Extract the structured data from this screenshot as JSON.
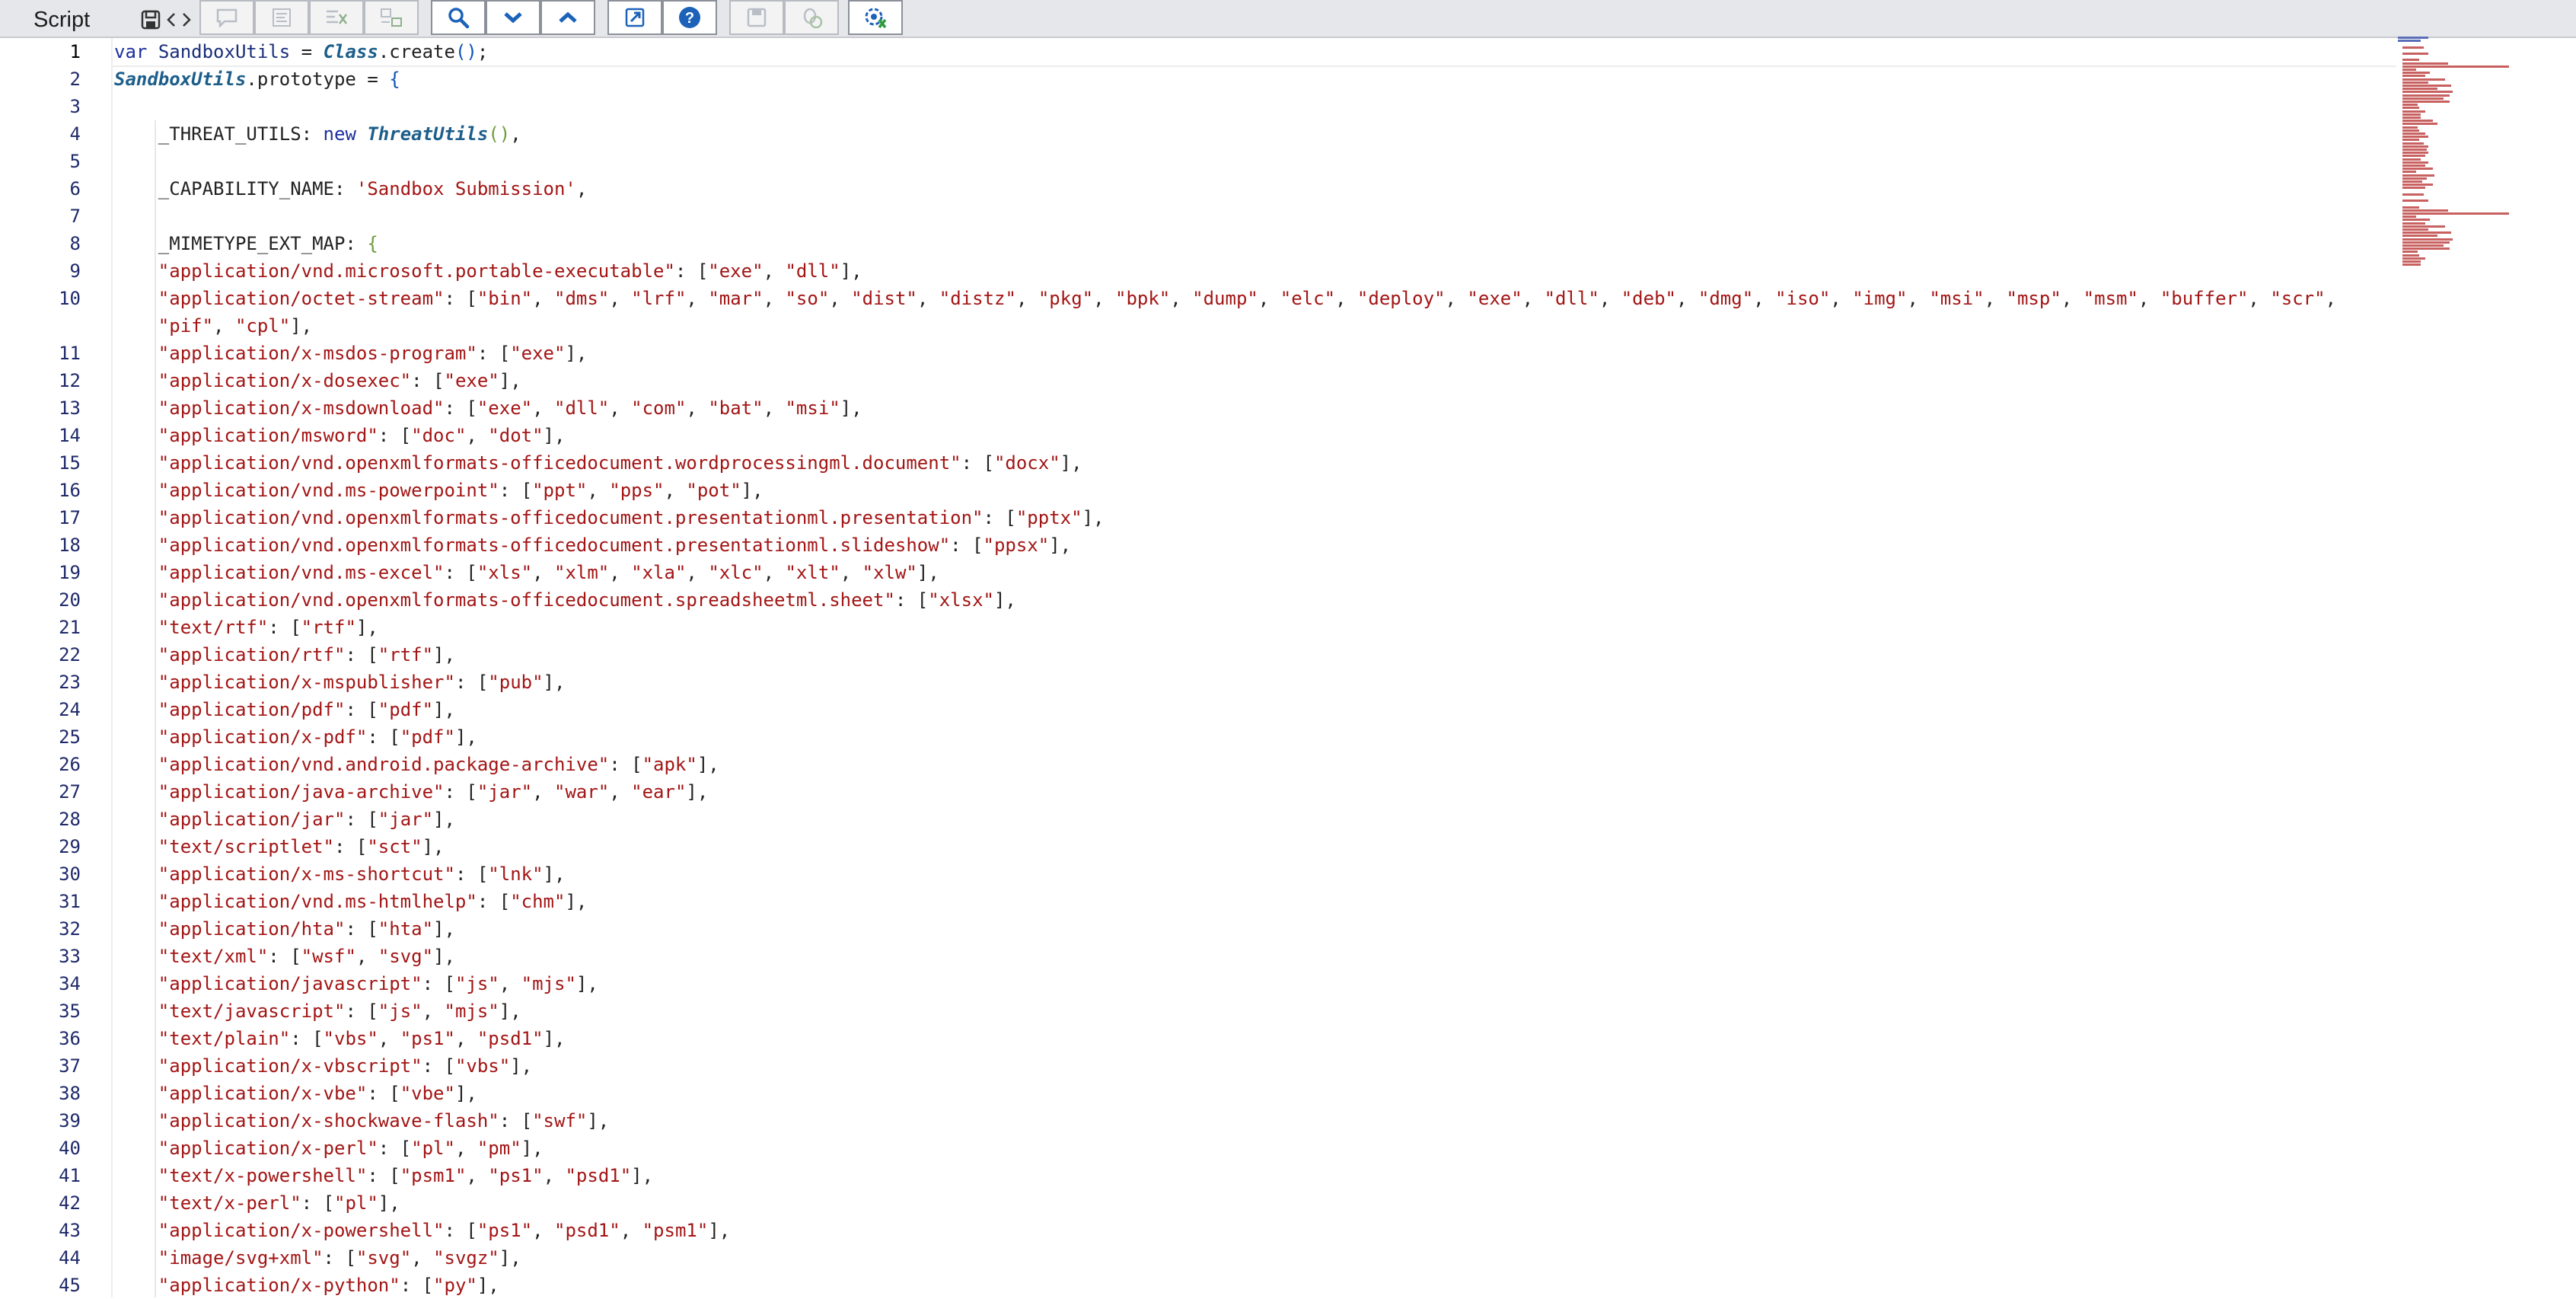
{
  "toolbar": {
    "title": "Script",
    "icons": [
      "save-icon",
      "code-toggle-icon",
      "comment-icon",
      "format-icon",
      "remove-comment-icon",
      "align-icon",
      "search-icon",
      "chevron-down-icon",
      "chevron-up-icon",
      "external-link-icon",
      "help-icon",
      "save-disk-icon",
      "bug-scan-icon",
      "debug-gear-icon"
    ]
  },
  "editor": {
    "active_line": 1,
    "lines": [
      {
        "n": "1",
        "text": "var SandboxUtils = Class.create();"
      },
      {
        "n": "2",
        "text": "SandboxUtils.prototype = {"
      },
      {
        "n": "3",
        "text": ""
      },
      {
        "n": "4",
        "text": "    _THREAT_UTILS: new ThreatUtils(),"
      },
      {
        "n": "5",
        "text": ""
      },
      {
        "n": "6",
        "text": "    _CAPABILITY_NAME: 'Sandbox Submission',"
      },
      {
        "n": "7",
        "text": ""
      },
      {
        "n": "8",
        "text": "    _MIMETYPE_EXT_MAP: {"
      },
      {
        "n": "9",
        "text": "    \"application/vnd.microsoft.portable-executable\": [\"exe\", \"dll\"],"
      },
      {
        "n": "10",
        "text": "    \"application/octet-stream\": [\"bin\", \"dms\", \"lrf\", \"mar\", \"so\", \"dist\", \"distz\", \"pkg\", \"bpk\", \"dump\", \"elc\", \"deploy\", \"exe\", \"dll\", \"deb\", \"dmg\", \"iso\", \"img\", \"msi\", \"msp\", \"msm\", \"buffer\", \"scr\","
      },
      {
        "n": "",
        "text": "    \"pif\", \"cpl\"],"
      },
      {
        "n": "11",
        "text": "    \"application/x-msdos-program\": [\"exe\"],"
      },
      {
        "n": "12",
        "text": "    \"application/x-dosexec\": [\"exe\"],"
      },
      {
        "n": "13",
        "text": "    \"application/x-msdownload\": [\"exe\", \"dll\", \"com\", \"bat\", \"msi\"],"
      },
      {
        "n": "14",
        "text": "    \"application/msword\": [\"doc\", \"dot\"],"
      },
      {
        "n": "15",
        "text": "    \"application/vnd.openxmlformats-officedocument.wordprocessingml.document\": [\"docx\"],"
      },
      {
        "n": "16",
        "text": "    \"application/vnd.ms-powerpoint\": [\"ppt\", \"pps\", \"pot\"],"
      },
      {
        "n": "17",
        "text": "    \"application/vnd.openxmlformats-officedocument.presentationml.presentation\": [\"pptx\"],"
      },
      {
        "n": "18",
        "text": "    \"application/vnd.openxmlformats-officedocument.presentationml.slideshow\": [\"ppsx\"],"
      },
      {
        "n": "19",
        "text": "    \"application/vnd.ms-excel\": [\"xls\", \"xlm\", \"xla\", \"xlc\", \"xlt\", \"xlw\"],"
      },
      {
        "n": "20",
        "text": "    \"application/vnd.openxmlformats-officedocument.spreadsheetml.sheet\": [\"xlsx\"],"
      },
      {
        "n": "21",
        "text": "    \"text/rtf\": [\"rtf\"],"
      },
      {
        "n": "22",
        "text": "    \"application/rtf\": [\"rtf\"],"
      },
      {
        "n": "23",
        "text": "    \"application/x-mspublisher\": [\"pub\"],"
      },
      {
        "n": "24",
        "text": "    \"application/pdf\": [\"pdf\"],"
      },
      {
        "n": "25",
        "text": "    \"application/x-pdf\": [\"pdf\"],"
      },
      {
        "n": "26",
        "text": "    \"application/vnd.android.package-archive\": [\"apk\"],"
      },
      {
        "n": "27",
        "text": "    \"application/java-archive\": [\"jar\", \"war\", \"ear\"],"
      },
      {
        "n": "28",
        "text": "    \"application/jar\": [\"jar\"],"
      },
      {
        "n": "29",
        "text": "    \"text/scriptlet\": [\"sct\"],"
      },
      {
        "n": "30",
        "text": "    \"application/x-ms-shortcut\": [\"lnk\"],"
      },
      {
        "n": "31",
        "text": "    \"application/vnd.ms-htmlhelp\": [\"chm\"],"
      },
      {
        "n": "32",
        "text": "    \"application/hta\": [\"hta\"],"
      },
      {
        "n": "33",
        "text": "    \"text/xml\": [\"wsf\", \"svg\"],"
      },
      {
        "n": "34",
        "text": "    \"application/javascript\": [\"js\", \"mjs\"],"
      },
      {
        "n": "35",
        "text": "    \"text/javascript\": [\"js\", \"mjs\"],"
      },
      {
        "n": "36",
        "text": "    \"text/plain\": [\"vbs\", \"ps1\", \"psd1\"],"
      },
      {
        "n": "37",
        "text": "    \"application/x-vbscript\": [\"vbs\"],"
      },
      {
        "n": "38",
        "text": "    \"application/x-vbe\": [\"vbe\"],"
      },
      {
        "n": "39",
        "text": "    \"application/x-shockwave-flash\": [\"swf\"],"
      },
      {
        "n": "40",
        "text": "    \"application/x-perl\": [\"pl\", \"pm\"],"
      },
      {
        "n": "41",
        "text": "    \"text/x-powershell\": [\"psm1\", \"ps1\", \"psd1\"],"
      },
      {
        "n": "42",
        "text": "    \"text/x-perl\": [\"pl\"],"
      },
      {
        "n": "43",
        "text": "    \"application/x-powershell\": [\"ps1\", \"psd1\", \"psm1\"],"
      },
      {
        "n": "44",
        "text": "    \"image/svg+xml\": [\"svg\", \"svgz\"],"
      },
      {
        "n": "45",
        "text": "    \"application/x-python\": [\"py\"],"
      }
    ]
  },
  "colors": {
    "keyword": "#1c2fa0",
    "class": "#1c5e8a",
    "string": "#a31515",
    "line_number": "#1f2a6a",
    "toolbar_bg": "#e6e7ea"
  }
}
